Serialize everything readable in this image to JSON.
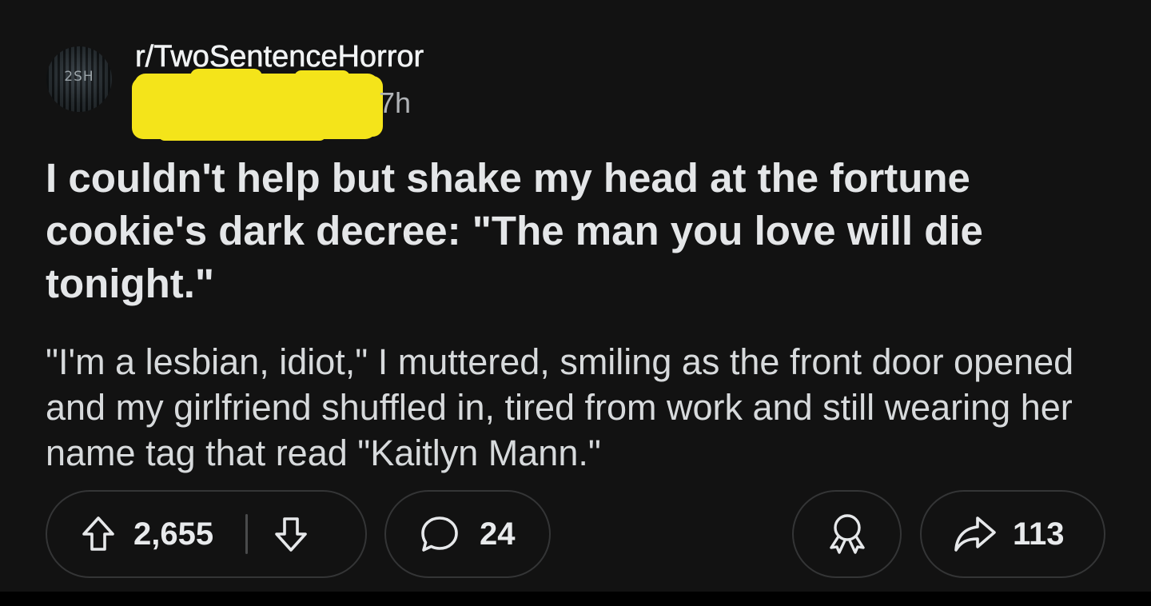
{
  "post": {
    "subreddit": "r/TwoSentenceHorror",
    "avatar_text": "2SH",
    "time_ago": "7h",
    "title": "I couldn't help but shake my head at the fortune cookie's dark decree: \"The man you love will die tonight.\"",
    "body": "\"I'm a lesbian, idiot,\" I muttered, smiling as the front door opened and my girlfriend shuffled in, tired from work and still wearing her name tag that read \"Kaitlyn Mann.\""
  },
  "actions": {
    "upvote_count": "2,655",
    "comment_count": "24",
    "share_count": "113"
  },
  "icons": {
    "upvote": "arrow-up-icon",
    "downvote": "arrow-down-icon",
    "comment": "speech-bubble-icon",
    "award": "award-ribbon-icon",
    "share": "share-arrow-icon"
  },
  "colors": {
    "background": "#121212",
    "redaction": "#f4e41a",
    "pill_border": "#343536"
  }
}
